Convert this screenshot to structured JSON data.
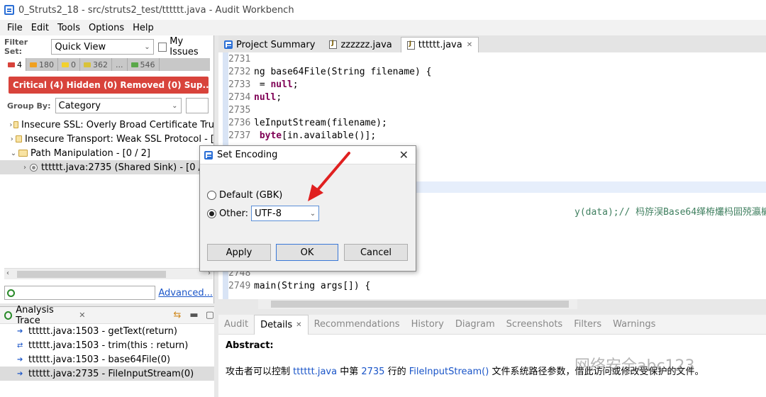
{
  "window": {
    "title": "0_Struts2_18 - src/struts2_test/tttttt.java - Audit Workbench"
  },
  "menu": [
    "File",
    "Edit",
    "Tools",
    "Options",
    "Help"
  ],
  "filter": {
    "label": "Filter Set:",
    "value": "Quick View",
    "my_issues": "My Issues"
  },
  "counts": [
    {
      "value": "4",
      "color": "#d8433b"
    },
    {
      "value": "180",
      "color": "#f0a020"
    },
    {
      "value": "0",
      "color": "#f2d12e"
    },
    {
      "value": "362",
      "color": "#d9c23a"
    },
    {
      "value": "...",
      "color": ""
    },
    {
      "value": "546",
      "color": "#5aa84a"
    }
  ],
  "banner": "Critical (4)  Hidden (0)  Removed (0)  Sup...",
  "groupby": {
    "label": "Group By:",
    "value": "Category"
  },
  "tree": [
    {
      "arrow": "›",
      "label": "Insecure SSL: Overly Broad Certificate Tru"
    },
    {
      "arrow": "›",
      "label": "Insecure Transport: Weak SSL Protocol - ["
    },
    {
      "arrow": "⌄",
      "label": "Path Manipulation - [0 / 2]"
    },
    {
      "arrow": "›",
      "label": "tttttt.java:2735 (Shared Sink) - [0 / 2"
    }
  ],
  "search": {
    "advanced": "Advanced..."
  },
  "trace": {
    "title": "Analysis Trace",
    "rows": [
      "tttttt.java:1503 - getText(return)",
      "tttttt.java:1503 - trim(this : return)",
      "tttttt.java:1503 - base64File(0)",
      "tttttt.java:2735 - FileInputStream(0)"
    ]
  },
  "editor_tabs": [
    "Project Summary",
    "zzzzzz.java",
    "tttttt.java"
  ],
  "code": [
    {
      "ln": "2731",
      "pre": "",
      "kw": "",
      "post": ""
    },
    {
      "ln": "2732",
      "pre": "ng base64File(String filename) {",
      "kw": "",
      "post": ""
    },
    {
      "ln": "2733",
      "pre": " = ",
      "kw": "null",
      "post": ";"
    },
    {
      "ln": "2734",
      "pre": "",
      "kw": "null",
      "post": ";"
    },
    {
      "ln": "2735",
      "pre": "",
      "kw": "",
      "post": ""
    },
    {
      "ln": "2736",
      "pre": "leInputStream(filename);",
      "kw": "",
      "post": ""
    },
    {
      "ln": "2737",
      "pre": " ",
      "kw": "byte",
      "post": "[in.available()];"
    },
    {
      "ln": "2748",
      "pre": "",
      "kw": "",
      "post": ""
    },
    {
      "ln": "2749",
      "pre": "main(String args[]) {",
      "kw": "",
      "post": ""
    }
  ],
  "code_right": "y(data);// 杩斿洖Base64缂栫爜杩囩殑瀛楄妭鏁扮粍瀛楃涓�",
  "dialog": {
    "title": "Set Encoding",
    "default_option": "Default (GBK)",
    "other_option": "Other:",
    "encoding": "UTF-8",
    "apply": "Apply",
    "ok": "OK",
    "cancel": "Cancel"
  },
  "bottom_tabs": [
    "Audit",
    "Details",
    "Recommendations",
    "History",
    "Diagram",
    "Screenshots",
    "Filters",
    "Warnings"
  ],
  "details": {
    "abstract_label": "Abstract:",
    "text_1": "攻击者可以控制 ",
    "file": "tttttt.java",
    "text_2": " 中第 ",
    "line": "2735",
    "text_3": " 行的 ",
    "api": "FileInputStream()",
    "text_4": " 文件系统路径参数，借此访问或修改受保护的文件。"
  },
  "watermark": "网络安全abc123"
}
